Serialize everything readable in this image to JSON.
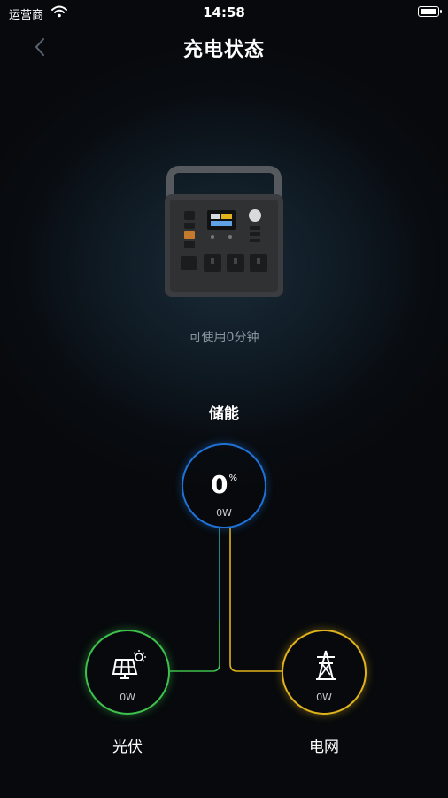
{
  "status_bar": {
    "carrier": "运营商",
    "time": "14:58"
  },
  "nav": {
    "title": "充电状态"
  },
  "device": {
    "usage_text": "可使用0分钟"
  },
  "flow": {
    "storage": {
      "label": "储能",
      "percent": "0",
      "percent_unit": "%",
      "power": "0W",
      "color": "#1f73d6"
    },
    "solar": {
      "label": "光伏",
      "power": "0W",
      "color": "#3ec14d"
    },
    "grid": {
      "label": "电网",
      "power": "0W",
      "color": "#e0b21c"
    }
  },
  "icons": [
    "chevron-left-icon",
    "wifi-icon",
    "battery-icon",
    "solar-panel-icon",
    "power-tower-icon"
  ]
}
